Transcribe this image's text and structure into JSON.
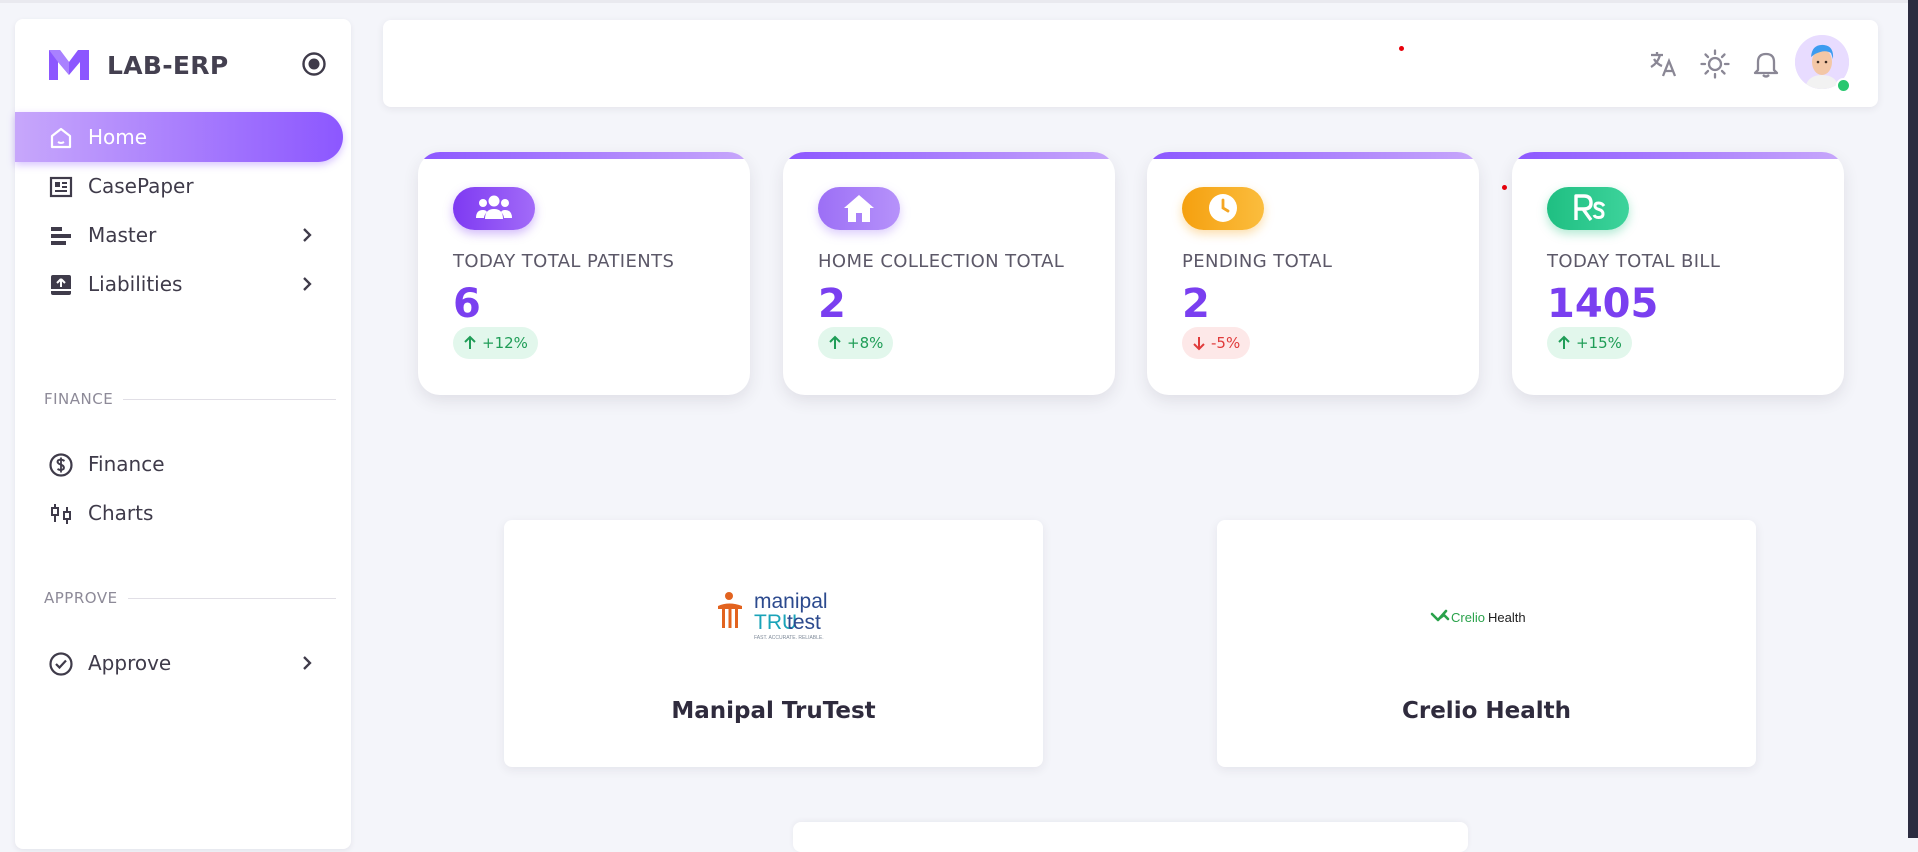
{
  "app": {
    "brand": "LAB-ERP",
    "accent": "#8c57ff"
  },
  "sidebar": {
    "items": [
      {
        "label": "Home",
        "icon": "home-icon",
        "active": true
      },
      {
        "label": "CasePaper",
        "icon": "newspaper-icon"
      },
      {
        "label": "Master",
        "icon": "align-left-icon",
        "has_children": true
      },
      {
        "label": "Liabilities",
        "icon": "upload-box-icon",
        "has_children": true
      }
    ],
    "sections": [
      {
        "title": "FINANCE",
        "items": [
          {
            "label": "Finance",
            "icon": "dollar-circle-icon"
          },
          {
            "label": "Charts",
            "icon": "candlestick-icon"
          }
        ]
      },
      {
        "title": "APPROVE",
        "items": [
          {
            "label": "Approve",
            "icon": "check-circle-icon",
            "has_children": true
          }
        ]
      }
    ]
  },
  "header": {
    "icons": [
      "translate-icon",
      "sun-icon",
      "bell-icon",
      "avatar"
    ],
    "avatar_status": "online"
  },
  "stats": [
    {
      "title": "TODAY TOTAL PATIENTS",
      "value": "6",
      "trend": "+12%",
      "direction": "up",
      "icon": "users-icon",
      "color": "#7e3af2"
    },
    {
      "title": "HOME COLLECTION TOTAL",
      "value": "2",
      "trend": "+8%",
      "direction": "up",
      "icon": "house-icon",
      "color": "#a27bf7"
    },
    {
      "title": "PENDING TOTAL",
      "value": "2",
      "trend": "-5%",
      "direction": "down",
      "icon": "clock-icon",
      "color": "#f5a623"
    },
    {
      "title": "TODAY TOTAL BILL",
      "value": "1405",
      "trend": "+15%",
      "direction": "up",
      "icon": "rupee-icon",
      "color": "#28c48a"
    }
  ],
  "partners": [
    {
      "name": "Manipal TruTest",
      "logo_line1": "manipal",
      "logo_line2a": "TRU",
      "logo_line2b": "test",
      "logo_tagline": "FAST. ACCURATE. RELIABLE."
    },
    {
      "name": "Crelio Health",
      "logo_text_a": "Crelio",
      "logo_text_b": "Health"
    }
  ]
}
